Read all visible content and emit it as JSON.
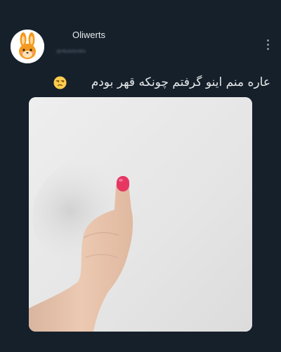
{
  "post": {
    "display_name": "Oliwerts",
    "handle": "@rfkzb3mWv",
    "text": "عاره  منم اینو گرفتم چونکه قهر بودم",
    "emoji": "unamused-face-icon"
  },
  "icons": {
    "avatar": "orange-bunny-icon",
    "more": "more-vertical-icon"
  },
  "colors": {
    "background": "#15202b",
    "text": "#e7e9ea",
    "secondary": "#8b98a5",
    "nail": "#e63763"
  }
}
